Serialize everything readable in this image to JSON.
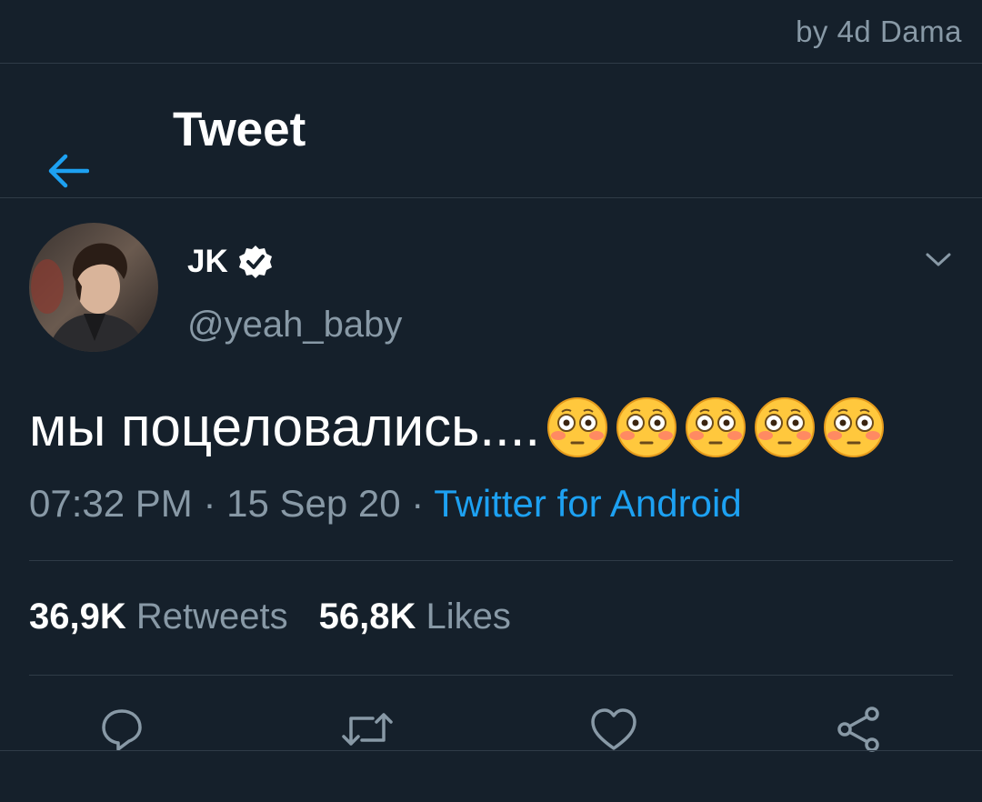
{
  "watermark": "by 4d Dama",
  "header": {
    "title": "Tweet",
    "back_icon": "arrow-left-icon",
    "accent_color": "#1da1f2"
  },
  "tweet": {
    "author": {
      "display_name": "JK",
      "handle": "@yeah_baby",
      "verified": true
    },
    "text": "мы поцеловались....",
    "emojis": [
      "flushed-face",
      "flushed-face",
      "flushed-face",
      "flushed-face",
      "flushed-face"
    ],
    "time": "07:32 PM",
    "date": "15 Sep 20",
    "separator": " · ",
    "source": "Twitter for Android",
    "stats": {
      "retweets_count": "36,9K",
      "retweets_label": "Retweets",
      "likes_count": "56,8K",
      "likes_label": "Likes"
    }
  },
  "actions": [
    {
      "name": "reply",
      "icon": "reply-icon"
    },
    {
      "name": "retweet",
      "icon": "retweet-icon"
    },
    {
      "name": "like",
      "icon": "heart-icon"
    },
    {
      "name": "share",
      "icon": "share-icon"
    }
  ],
  "colors": {
    "background": "#15202b",
    "secondary_text": "#8899a6",
    "link": "#1da1f2",
    "divider": "#2f3b47"
  }
}
